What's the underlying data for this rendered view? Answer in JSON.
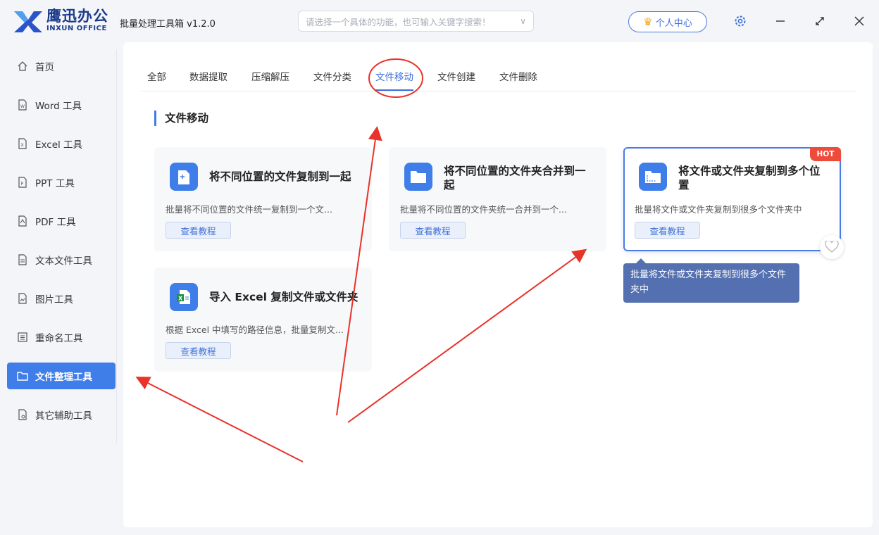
{
  "app": {
    "logo_cn": "鹰迅办公",
    "logo_en": "INXUN OFFICE",
    "title": "批量处理工具箱 v1.2.0"
  },
  "search": {
    "placeholder": "请选择一个具体的功能，也可输入关键字搜索！"
  },
  "header": {
    "user_center_label": "个人中心"
  },
  "sidebar": {
    "items": [
      {
        "label": "首页",
        "icon": "home-icon"
      },
      {
        "label": "Word 工具",
        "icon": "file-icon"
      },
      {
        "label": "Excel 工具",
        "icon": "file-icon"
      },
      {
        "label": "PPT 工具",
        "icon": "file-icon"
      },
      {
        "label": "PDF 工具",
        "icon": "file-icon"
      },
      {
        "label": "文本文件工具",
        "icon": "file-icon"
      },
      {
        "label": "图片工具",
        "icon": "file-icon"
      },
      {
        "label": "重命名工具",
        "icon": "list-icon"
      },
      {
        "label": "文件整理工具",
        "icon": "folder-icon",
        "active": true
      },
      {
        "label": "其它辅助工具",
        "icon": "file-icon"
      }
    ]
  },
  "tabs": [
    "全部",
    "数据提取",
    "压缩解压",
    "文件分类",
    "文件移动",
    "文件创建",
    "文件删除"
  ],
  "active_tab": "文件移动",
  "section_title": "文件移动",
  "cards": [
    {
      "title": "将不同位置的文件复制到一起",
      "desc": "批量将不同位置的文件统一复制到一个文...",
      "button": "查看教程"
    },
    {
      "title": "将不同位置的文件夹合并到一起",
      "desc": "批量将不同位置的文件夹统一合并到一个...",
      "button": "查看教程"
    },
    {
      "title": "将文件或文件夹复制到多个位置",
      "desc": "批量将文件或文件夹复制到很多个文件夹中",
      "button": "查看教程",
      "badge": "HOT"
    },
    {
      "title": "导入 Excel 复制文件或文件夹",
      "desc": "根据 Excel 中填写的路径信息，批量复制文...",
      "button": "查看教程"
    }
  ],
  "tooltip": "批量将文件或文件夹复制到很多个文件夹中",
  "colors": {
    "accent": "#3f7ee8",
    "annotation": "#e8322a",
    "hot": "#ef4b3a"
  }
}
